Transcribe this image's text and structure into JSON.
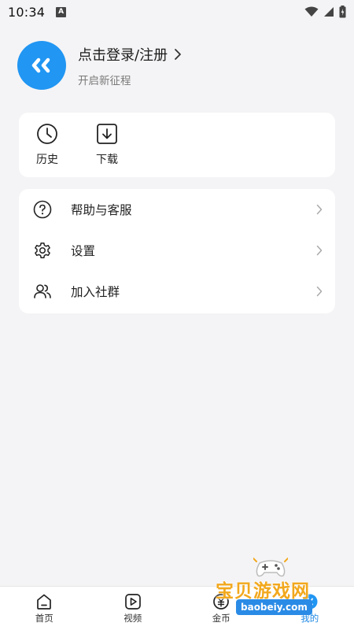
{
  "status_bar": {
    "time": "10:34",
    "notification_icon": "A"
  },
  "profile": {
    "login_label": "点击登录/注册",
    "subtitle": "开启新征程",
    "avatar_icon": "quote-icon",
    "accent_color": "#2196f3"
  },
  "quick_actions": [
    {
      "label": "历史",
      "icon": "clock-icon"
    },
    {
      "label": "下载",
      "icon": "download-icon"
    }
  ],
  "menu": [
    {
      "label": "帮助与客服",
      "icon": "help-circle-icon"
    },
    {
      "label": "设置",
      "icon": "gear-icon"
    },
    {
      "label": "加入社群",
      "icon": "users-icon"
    }
  ],
  "bottom_nav": [
    {
      "label": "首页",
      "icon": "home-icon"
    },
    {
      "label": "视频",
      "icon": "play-icon"
    },
    {
      "label": "金币",
      "icon": "coin-icon"
    },
    {
      "label": "我的",
      "icon": "profile-icon",
      "active": true
    }
  ],
  "watermark": {
    "title": "宝贝游戏网",
    "url": "baobeiy.com"
  }
}
